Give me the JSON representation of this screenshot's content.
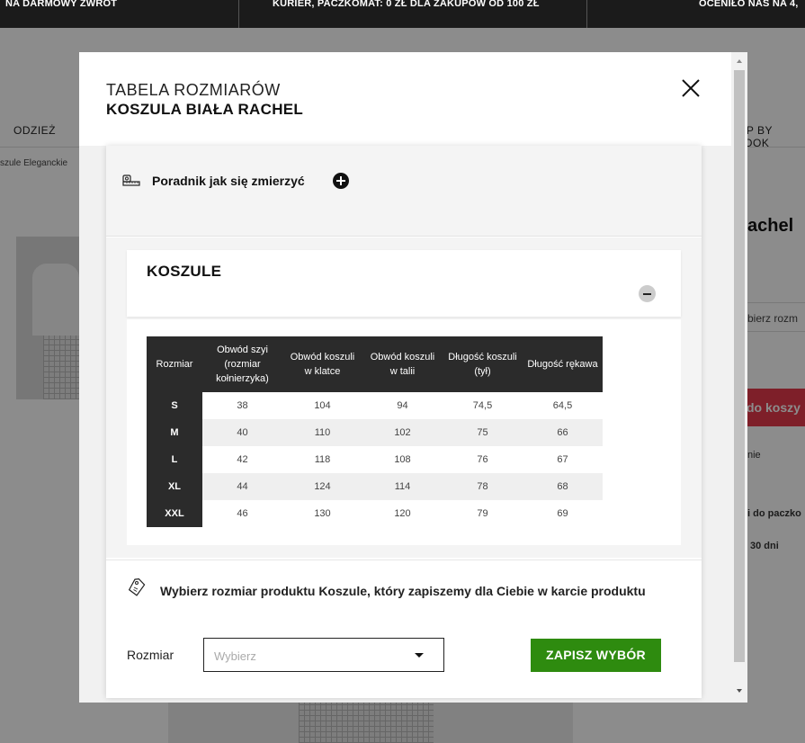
{
  "announcement_bar": {
    "messages": [
      "NA DARMOWY ZWROT",
      "KURIER, PACZKOMAT: 0 ZŁ DLA ZAKUPÓW OD 100 ZŁ",
      "OCENIŁO NAS NA 4,"
    ]
  },
  "background_page": {
    "nav_left": "ODZIEŻ",
    "nav_right": "OP BY LOOK",
    "breadcrumb": "szule Eleganckie",
    "product_title_partial": "achel",
    "select_partial": "bierz rozm",
    "cart_button_partial": "do koszy",
    "info_1": "nie",
    "info_2": "i do paczko",
    "info_3": "30 dni"
  },
  "modal": {
    "title_line1": "TABELA ROZMIARÓW",
    "title_line2": "KOSZULA BIAŁA RACHEL",
    "close_icon": "close-x-icon",
    "guide_label": "Poradnik jak się zmierzyć",
    "section_title": "KOSZULE",
    "table": {
      "headers": [
        "Rozmiar",
        "Obwód szyi (rozmiar kołnierzyka)",
        "Obwód koszuli w klatce",
        "Obwód koszuli w talii",
        "Długość koszuli (tył)",
        "Długość rękawa"
      ],
      "rows": [
        [
          "S",
          "38",
          "104",
          "94",
          "74,5",
          "64,5"
        ],
        [
          "M",
          "40",
          "110",
          "102",
          "75",
          "66"
        ],
        [
          "L",
          "42",
          "118",
          "108",
          "76",
          "67"
        ],
        [
          "XL",
          "44",
          "124",
          "114",
          "78",
          "68"
        ],
        [
          "XXL",
          "46",
          "130",
          "120",
          "79",
          "69"
        ]
      ]
    },
    "footer_text": "Wybierz rozmiar produktu Koszule, który zapiszemy dla Ciebie w karcie produktu",
    "size_label": "Rozmiar",
    "size_placeholder": "Wybierz",
    "save_button": "ZAPISZ WYBÓR"
  },
  "colors": {
    "save_green": "#2e8b0f",
    "table_dark": "#2b2b2b",
    "cart_red": "#e53a4b"
  }
}
